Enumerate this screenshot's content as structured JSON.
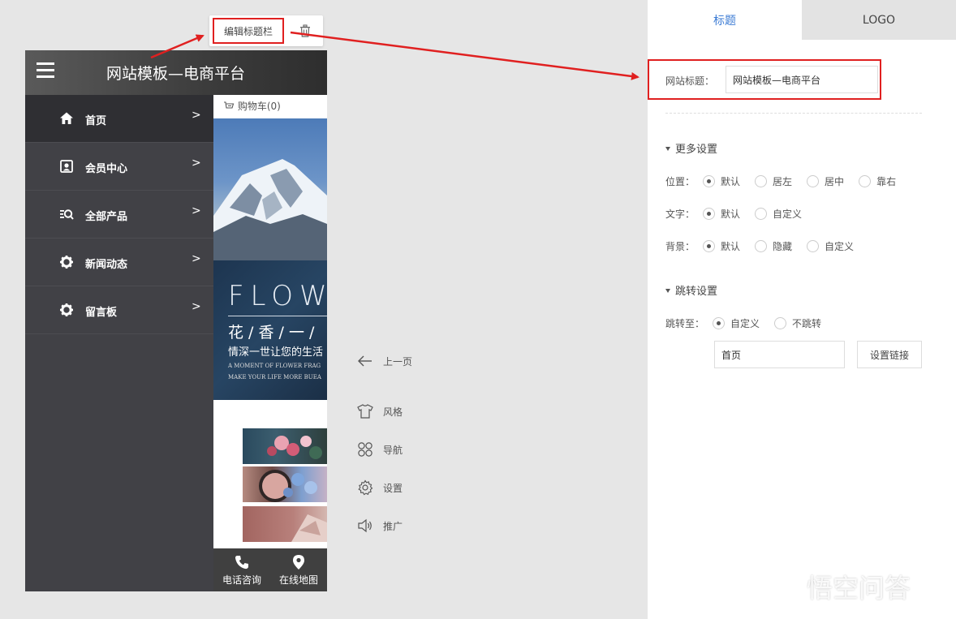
{
  "toolbar": {
    "edit_title_label": "编辑标题栏"
  },
  "phone": {
    "title": "网站模板—电商平台",
    "menu": [
      {
        "label": "首页",
        "icon": "home-icon",
        "arrow": ">"
      },
      {
        "label": "会员中心",
        "icon": "user-card-icon",
        "arrow": ">"
      },
      {
        "label": "全部产品",
        "icon": "product-list-icon",
        "arrow": ">"
      },
      {
        "label": "新闻动态",
        "icon": "gear-icon",
        "arrow": ">"
      },
      {
        "label": "留言板",
        "icon": "gear-icon",
        "arrow": ">"
      }
    ],
    "cart_label": "购物车(0)",
    "banner": {
      "big": "FLOW",
      "cn": "花 / 香 / 一 /",
      "sub": "情深一世让您的生活",
      "en1": "A MOMENT OF FLOWER FRAG",
      "en2": "MAKE YOUR LIFE MORE BUEA"
    },
    "bottom": {
      "phone_label": "电话咨询",
      "map_label": "在线地图"
    }
  },
  "tools": {
    "prev_label": "上一页",
    "style_label": "风格",
    "nav_label": "导航",
    "settings_label": "设置",
    "promo_label": "推广"
  },
  "panel": {
    "tabs": {
      "title_tab": "标题",
      "logo_tab": "LOGO"
    },
    "site_title_label": "网站标题：",
    "site_title_value": "网站模板—电商平台",
    "more_settings": "更多设置",
    "position": {
      "label": "位置：",
      "options": [
        "默认",
        "居左",
        "居中",
        "靠右"
      ],
      "selected": "默认"
    },
    "text": {
      "label": "文字：",
      "options": [
        "默认",
        "自定义"
      ],
      "selected": "默认"
    },
    "background": {
      "label": "背景：",
      "options": [
        "默认",
        "隐藏",
        "自定义"
      ],
      "selected": "默认"
    },
    "jump_settings": "跳转设置",
    "jump": {
      "label": "跳转至：",
      "options": [
        "自定义",
        "不跳转"
      ],
      "selected": "自定义"
    },
    "link_value": "首页",
    "set_link_label": "设置链接"
  },
  "watermark": "悟空问答",
  "colors": {
    "highlight": "#e02020",
    "tab_active": "#3b7bd4",
    "sidebar": "#414146"
  }
}
